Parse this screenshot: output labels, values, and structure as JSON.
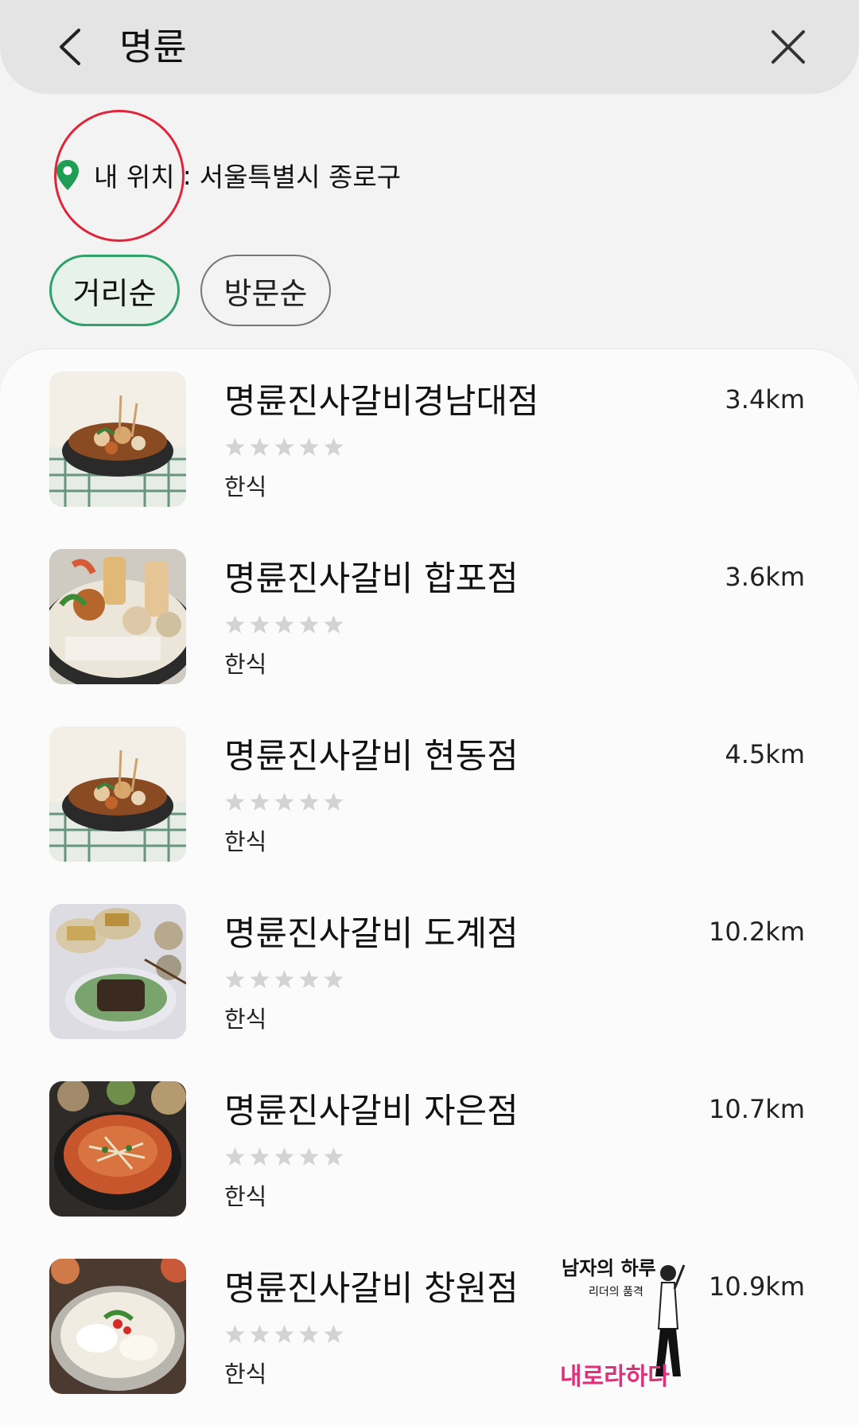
{
  "search": {
    "query": "명륜"
  },
  "location": {
    "label": "내 위치",
    "separator": ":",
    "value": "서울특별시 종로구"
  },
  "sort": {
    "distance_label": "거리순",
    "visit_label": "방문순",
    "active": "거리순"
  },
  "results": [
    {
      "name": "명륜진사갈비경남대점",
      "distance": "3.4km",
      "rating": 0,
      "category": "한식"
    },
    {
      "name": "명륜진사갈비 합포점",
      "distance": "3.6km",
      "rating": 0,
      "category": "한식"
    },
    {
      "name": "명륜진사갈비 현동점",
      "distance": "4.5km",
      "rating": 0,
      "category": "한식"
    },
    {
      "name": "명륜진사갈비 도계점",
      "distance": "10.2km",
      "rating": 0,
      "category": "한식"
    },
    {
      "name": "명륜진사갈비 자은점",
      "distance": "10.7km",
      "rating": 0,
      "category": "한식"
    },
    {
      "name": "명륜진사갈비 창원점",
      "distance": "10.9km",
      "rating": 0,
      "category": "한식"
    }
  ],
  "watermark": {
    "line1": "남자의 하루",
    "line2": "리더의 품격",
    "line3": "내로라하다"
  },
  "colors": {
    "accent_green": "#2fa26b",
    "highlight_red": "#e0243a",
    "star_empty": "#d3d3d3"
  },
  "icons": {
    "back": "chevron-left-icon",
    "close": "close-icon",
    "location": "map-pin-icon",
    "rating": "star-icon"
  }
}
